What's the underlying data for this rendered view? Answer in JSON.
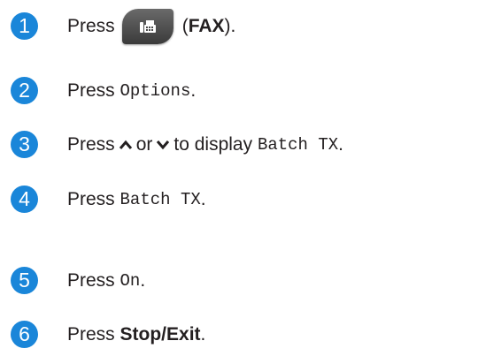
{
  "steps": [
    {
      "num": "1",
      "text_before": "Press",
      "paren_open": "(",
      "bold": "FAX",
      "paren_close": ").",
      "icon": "fax-icon"
    },
    {
      "num": "2",
      "text_before": "Press",
      "mono": "Options",
      "text_after": "."
    },
    {
      "num": "3",
      "text_before": "Press",
      "text_mid1": "or",
      "text_mid2": "to display",
      "mono": "Batch TX",
      "text_after": ".",
      "icons": [
        "chevron-up-icon",
        "chevron-down-icon"
      ]
    },
    {
      "num": "4",
      "text_before": "Press",
      "mono": "Batch TX",
      "text_after": "."
    },
    {
      "num": "5",
      "text_before": "Press",
      "mono": "On",
      "text_after": "."
    },
    {
      "num": "6",
      "text_before": "Press",
      "bold": "Stop/Exit",
      "text_after": "."
    }
  ],
  "colors": {
    "step_badge": "#1a86d9",
    "text": "#231f20",
    "button": "#4a4a4a"
  }
}
